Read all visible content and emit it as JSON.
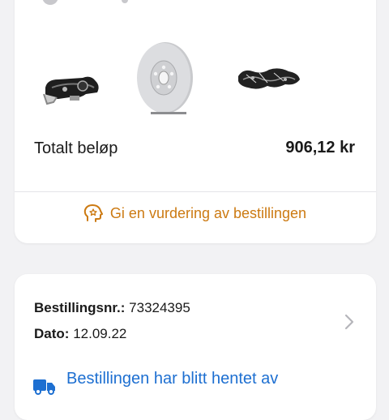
{
  "order_summary": {
    "products": [
      {
        "icon": "brake-caliper-image"
      },
      {
        "icon": "brake-disc-image"
      },
      {
        "icon": "brake-pads-image"
      }
    ],
    "total_label": "Totalt beløp",
    "total_value": "906,12 kr",
    "rate_label": "Gi en vurdering av bestillingen"
  },
  "order": {
    "number_label": "Bestillingsnr.:",
    "number_value": "73324395",
    "date_label": "Dato:",
    "date_value": "12.09.22",
    "status_text": "Bestillingen har blitt hentet av"
  },
  "colors": {
    "accent_orange": "#cc7a12",
    "link_blue": "#1d6fd1",
    "background": "#f2f2f4"
  }
}
